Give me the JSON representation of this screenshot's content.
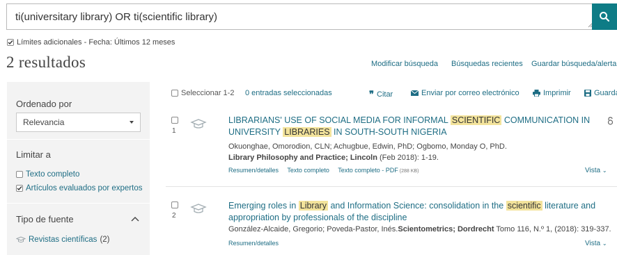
{
  "search": {
    "query": "ti(universitary library) OR ti(scientific library)"
  },
  "limits": {
    "text": "Límites adicionales - Fecha: Últimos 12 meses"
  },
  "results": {
    "count_label": "2 resultados"
  },
  "top_links": {
    "modify": "Modificar búsqueda",
    "recent": "Búsquedas recientes",
    "save": "Guardar búsqueda/alerta"
  },
  "sidebar": {
    "sort_title": "Ordenado por",
    "sort_value": "Relevancia",
    "limit_title": "Limitar a",
    "full_text": "Texto completo",
    "peer_reviewed": "Artículos evaluados por expertos",
    "source_title": "Tipo de fuente",
    "source_item": "Revistas científicas",
    "source_count": "(2)"
  },
  "toolbar": {
    "select_label": "Seleccionar 1-2",
    "selected_label": "0 entradas seleccionadas",
    "cite": "Citar",
    "email": "Enviar por correo electrónico",
    "print": "Imprimir",
    "save": "Guarda"
  },
  "items": [
    {
      "num": "1",
      "title_1": "LIBRARIANS' USE OF SOCIAL MEDIA FOR INFORMAL ",
      "title_hl_1": "SCIENTIFIC",
      "title_2": " COMMUNICATION IN",
      "title_3": "UNIVERSITY ",
      "title_hl_2": "LIBRARIES",
      "title_4": " IN SOUTH-SOUTH NIGERIA",
      "authors": "Okuonghae, Omorodion, CLN; Achugbue, Edwin, PhD; Ogbomo, Monday O, PhD.",
      "source_bold": "Library Philosophy and Practice; Lincoln",
      "source_rest": " (Feb 2018): 1-19.",
      "link_1": "Resumen/detalles",
      "link_2": "Texto completo",
      "link_3": "Texto completo - PDF",
      "link_3_size": "(288 KB)",
      "vista": "Vista"
    },
    {
      "num": "2",
      "title_1": "Emerging roles in ",
      "title_hl_1": "Library",
      "title_2": " and Information Science: consolidation in the ",
      "title_hl_2": "scientific",
      "title_3": " literature and",
      "title_4": "appropriation by professionals of the discipline",
      "authors": "González-Alcaide, Gregorio; Poveda-Pastor, Inés.",
      "source_bold": "Scientometrics; Dordrecht",
      "source_rest": " Tomo 116, N.º 1,  (2018): 319-337.",
      "link_1": "Resumen/detalles",
      "vista": "Vista"
    }
  ],
  "colors": {
    "accent": "#0e7c86",
    "link": "#1e6d84",
    "highlight": "#f3e39b",
    "sidebar_bg": "#f3f3f3"
  }
}
